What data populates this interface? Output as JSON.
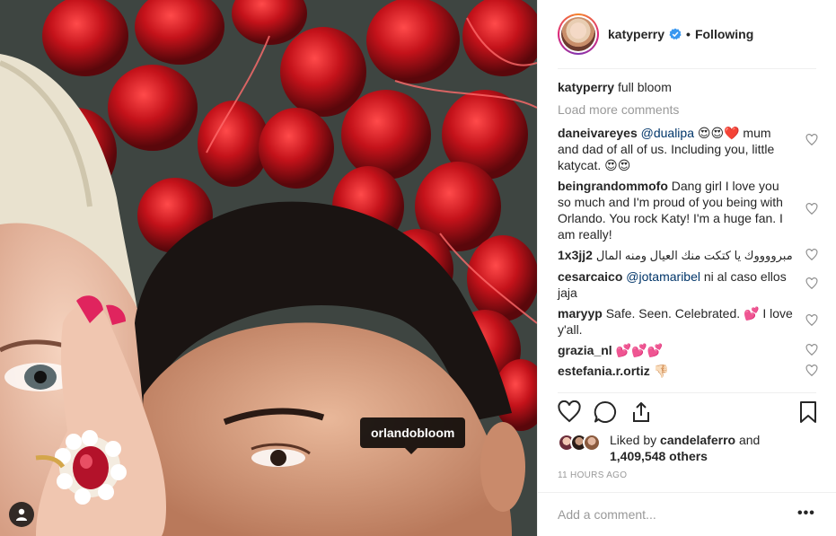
{
  "post": {
    "author": "katyperry",
    "follow_status": "Following",
    "separator": "•",
    "photo_tag": "orlandobloom",
    "caption": {
      "user": "katyperry",
      "text": "full bloom"
    },
    "load_more": "Load more comments",
    "comments": [
      {
        "user": "daneivareyes",
        "mention": "@dualipa",
        "text": " 😍😍❤️ mum and dad of all of us. Including you, little katycat. 😍😍"
      },
      {
        "user": "beingrandommofo",
        "text": "Dang girl I love you so much and I'm proud of you being with Orlando. You rock Katy! I'm a huge fan. I am really!"
      },
      {
        "user": "1x3jj2",
        "text": "مبرووووك يا كتكت منك العيال ومنه المال"
      },
      {
        "user": "cesarcaico",
        "mention": "@jotamaribel",
        "text": " ni al caso ellos jaja"
      },
      {
        "user": "maryyp",
        "text": "Safe. Seen. Celebrated. 💕 I love y'all."
      },
      {
        "user": "grazia_nl",
        "text": "💕💕💕"
      },
      {
        "user": "estefania.r.ortiz",
        "text": "👎🏻"
      }
    ],
    "likes": {
      "prefix": "Liked by",
      "user": "candelaferro",
      "and": "and",
      "count": "1,409,548 others"
    },
    "time": "11 HOURS AGO",
    "add_comment_placeholder": "Add a comment...",
    "more": "•••"
  },
  "colors": {
    "verified": "#3897f0",
    "mention": "#003569",
    "muted": "#999999"
  },
  "icons": [
    "verified-badge-icon",
    "heart-icon",
    "comment-icon",
    "share-icon",
    "bookmark-icon",
    "user-tag-icon",
    "more-options-icon"
  ]
}
